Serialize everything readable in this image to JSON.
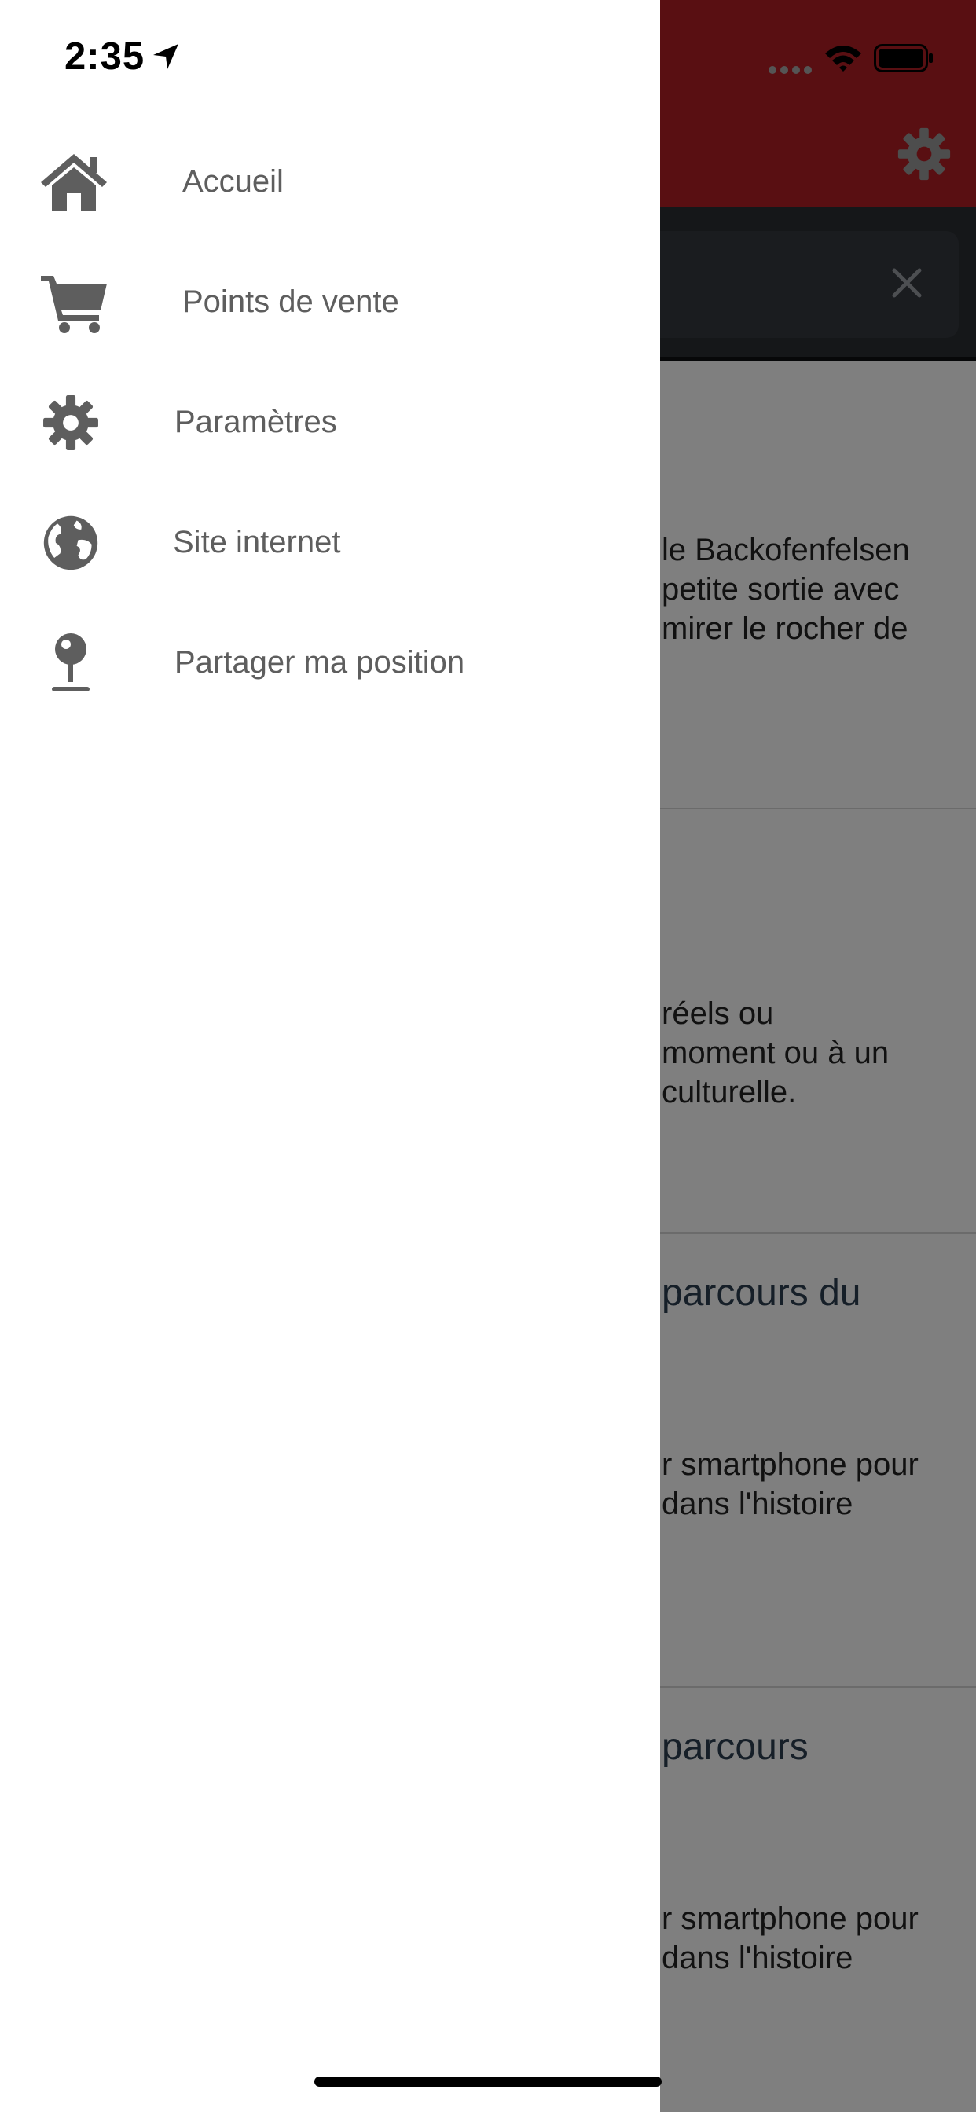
{
  "status_bar": {
    "time": "2:35"
  },
  "drawer": {
    "items": [
      {
        "label": "Accueil",
        "icon": "home-icon"
      },
      {
        "label": "Points de vente",
        "icon": "cart-icon"
      },
      {
        "label": "Paramètres",
        "icon": "gear-icon"
      },
      {
        "label": "Site internet",
        "icon": "globe-icon"
      },
      {
        "label": "Partager ma position",
        "icon": "map-pin-icon"
      }
    ]
  },
  "background": {
    "cards": [
      {
        "title": "",
        "lines": [
          "le Backofenfelsen",
          "petite sortie avec",
          "mirer le rocher de"
        ]
      },
      {
        "title": "",
        "lines": [
          "réels ou",
          "moment ou à un",
          "culturelle."
        ]
      },
      {
        "title": "parcours du",
        "lines": [
          "r smartphone pour",
          "dans l'histoire"
        ]
      },
      {
        "title": "parcours",
        "lines": [
          "r smartphone pour",
          "dans l'histoire"
        ]
      }
    ]
  },
  "colors": {
    "header": "#b21f24",
    "drawer_text": "#5e5e5e",
    "drawer_icon": "#5e5e5e"
  }
}
